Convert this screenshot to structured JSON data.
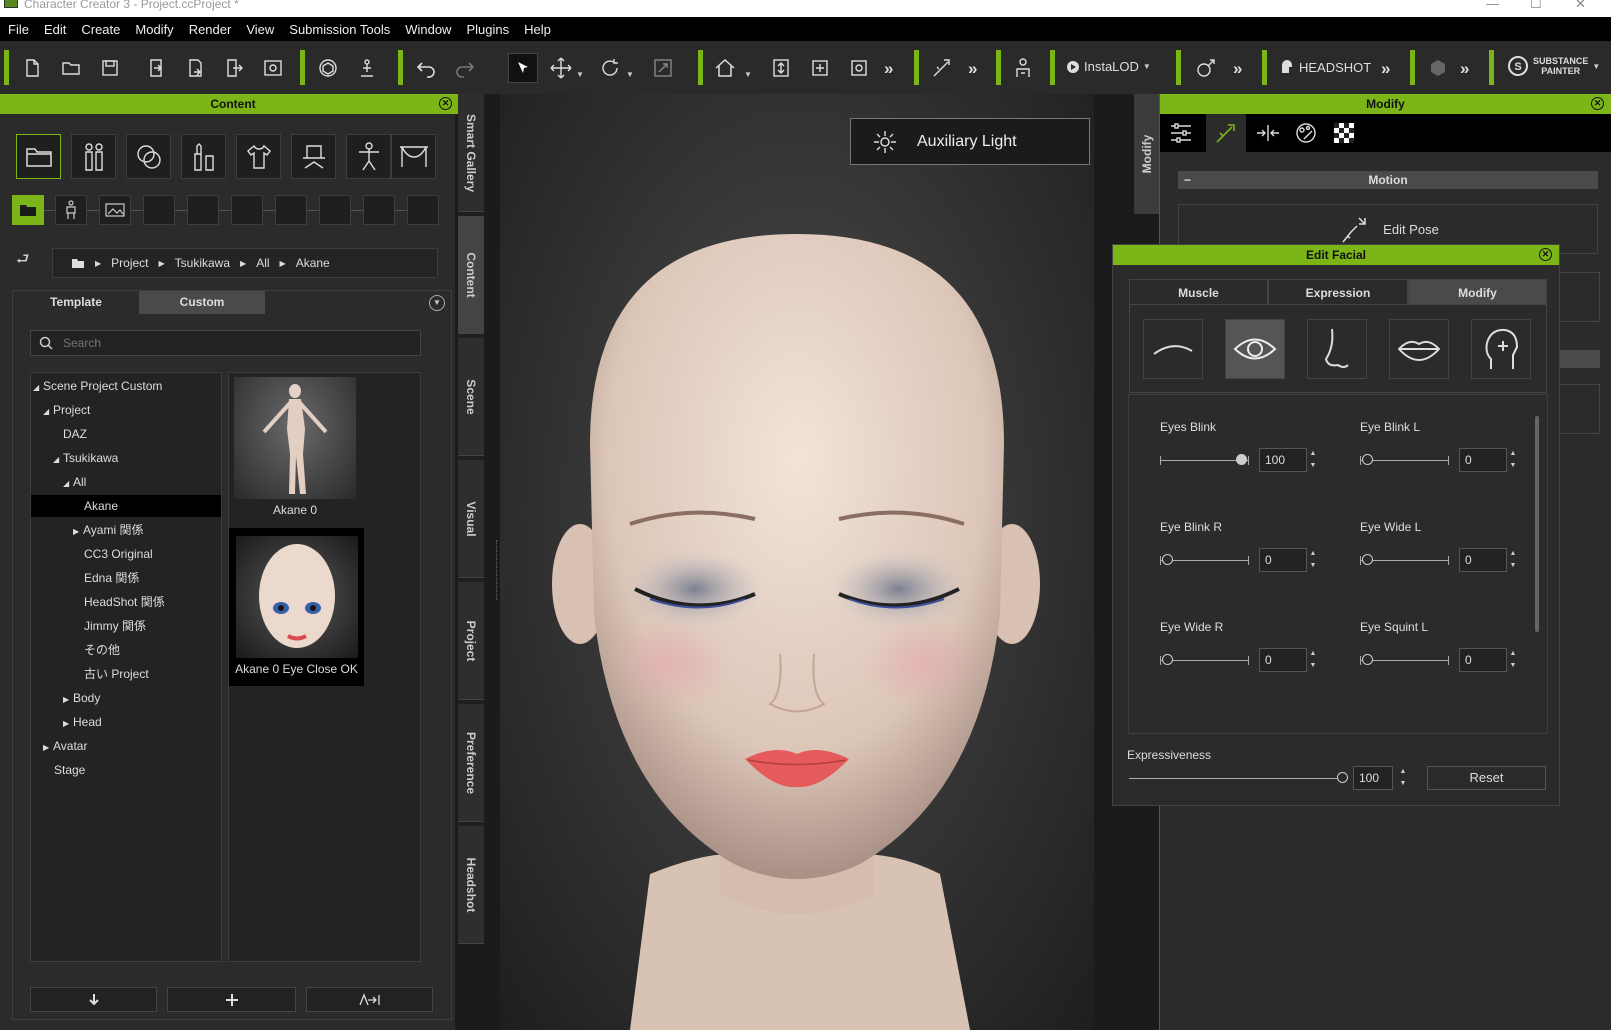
{
  "window": {
    "title": "Character Creator 3 - Project.ccProject *",
    "controls": [
      "—",
      "☐",
      "✕"
    ]
  },
  "menu": [
    "File",
    "Edit",
    "Create",
    "Modify",
    "Render",
    "View",
    "Submission Tools",
    "Window",
    "Plugins",
    "Help"
  ],
  "toolbar": {
    "instalod": "InstaLOD",
    "headshot": "HEADSHOT",
    "substance_line1": "SUBSTANCE",
    "substance_line2": "PAINTER",
    "more": "»"
  },
  "content_panel": {
    "title": "Content",
    "breadcrumb": [
      "Project",
      "Tsukikawa",
      "All",
      "Akane"
    ],
    "tabs": [
      "Template",
      "Custom"
    ],
    "active_tab": "Custom",
    "search_placeholder": "Search",
    "tree": [
      {
        "label": "Scene Project Custom",
        "arrow": "◢"
      },
      {
        "label": "Project",
        "arrow": "◢"
      },
      {
        "label": "DAZ",
        "arrow": ""
      },
      {
        "label": "Tsukikawa",
        "arrow": "◢"
      },
      {
        "label": "All",
        "arrow": "◢"
      },
      {
        "label": "Akane",
        "arrow": ""
      },
      {
        "label": "Ayami 関係",
        "arrow": "▶"
      },
      {
        "label": "CC3 Original",
        "arrow": ""
      },
      {
        "label": "Edna 関係",
        "arrow": ""
      },
      {
        "label": "HeadShot 関係",
        "arrow": ""
      },
      {
        "label": "Jimmy 関係",
        "arrow": ""
      },
      {
        "label": "その他",
        "arrow": ""
      },
      {
        "label": "古い Project",
        "arrow": ""
      },
      {
        "label": "Body",
        "arrow": "▶"
      },
      {
        "label": "Head",
        "arrow": "▶"
      },
      {
        "label": "Avatar",
        "arrow": "▶"
      },
      {
        "label": "Stage",
        "arrow": ""
      }
    ],
    "selected_tree_item": "Akane",
    "thumbnails": [
      "Akane 0",
      "Akane 0 Eye Close OK"
    ]
  },
  "side_tabs": [
    "Smart Gallery",
    "Content",
    "Scene",
    "Visual",
    "Project",
    "Preference",
    "Headshot"
  ],
  "active_side_tab": "Content",
  "viewport": {
    "aux_light_label": "Auxiliary Light"
  },
  "modify_panel": {
    "title": "Modify",
    "strip_label": "Modify",
    "motion_header": "Motion",
    "collapse": "−",
    "edit_pose": "Edit Pose"
  },
  "edit_facial": {
    "title": "Edit Facial",
    "tabs": [
      "Muscle",
      "Expression",
      "Modify"
    ],
    "active_tab": "Modify",
    "feature_icons": [
      "eyebrow-icon",
      "eye-icon",
      "nose-icon",
      "lips-icon",
      "head-icon"
    ],
    "active_feature": "eye-icon",
    "sliders": [
      {
        "label": "Eyes Blink",
        "value": 100,
        "max": 100
      },
      {
        "label": "Eye Blink L",
        "value": 0,
        "max": 100
      },
      {
        "label": "Eye Blink R",
        "value": 0,
        "max": 100
      },
      {
        "label": "Eye Wide L",
        "value": 0,
        "max": 100
      },
      {
        "label": "Eye Wide R",
        "value": 0,
        "max": 100
      },
      {
        "label": "Eye Squint L",
        "value": 0,
        "max": 100
      }
    ],
    "expressiveness": {
      "label": "Expressiveness",
      "value": 100,
      "max": 100
    },
    "reset_label": "Reset",
    "spin_up": "▲",
    "spin_down": "▼"
  }
}
